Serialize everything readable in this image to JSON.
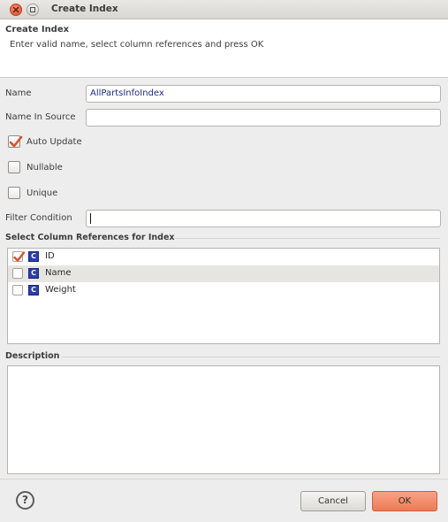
{
  "window": {
    "title": "Create Index"
  },
  "header": {
    "title": "Create Index",
    "message": "Enter valid name, select column references and press OK"
  },
  "form": {
    "name_label": "Name",
    "name_value": "AllPartsInfoIndex",
    "name_in_source_label": "Name In Source",
    "name_in_source_value": "",
    "auto_update_label": "Auto Update",
    "auto_update_checked": true,
    "nullable_label": "Nullable",
    "nullable_checked": false,
    "unique_label": "Unique",
    "unique_checked": false,
    "filter_condition_label": "Filter Condition",
    "filter_condition_value": ""
  },
  "columns": {
    "group_title": "Select Column References for Index",
    "icon_glyph": "C",
    "items": [
      {
        "name": "ID",
        "checked": true,
        "selected": false
      },
      {
        "name": "Name",
        "checked": false,
        "selected": true
      },
      {
        "name": "Weight",
        "checked": false,
        "selected": false
      }
    ]
  },
  "description": {
    "group_title": "Description",
    "value": ""
  },
  "footer": {
    "help_glyph": "?",
    "cancel_label": "Cancel",
    "ok_label": "OK"
  },
  "colors": {
    "accent": "#ee7a55",
    "column_icon": "#2b3ea8",
    "checkmark": "#d9522c"
  }
}
